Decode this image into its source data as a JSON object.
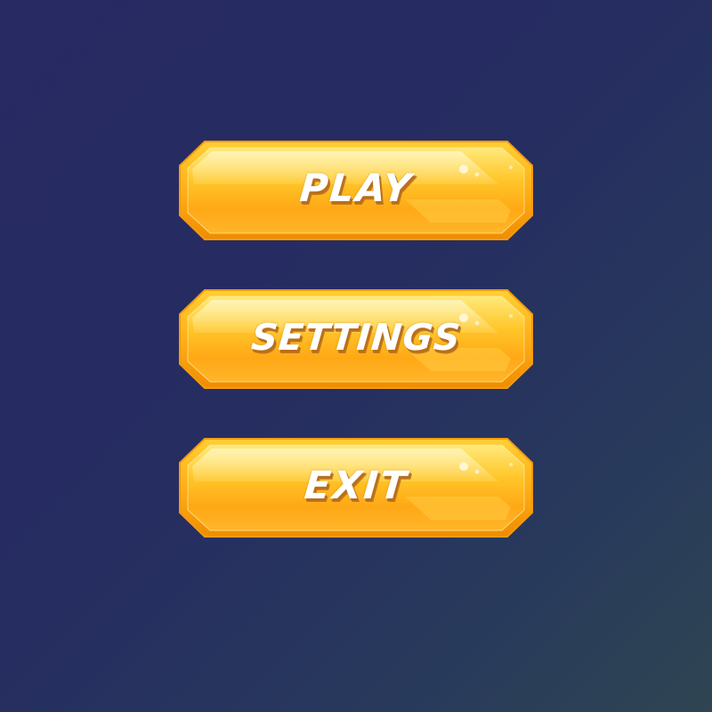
{
  "main_menu": {
    "buttons": [
      {
        "label": "PLAY"
      },
      {
        "label": "SETTINGS"
      },
      {
        "label": "EXIT"
      }
    ]
  },
  "colors": {
    "background_top": "#272a63",
    "background_bottom": "#2f4552",
    "button_fill_top": "#ffd44a",
    "button_fill_bottom": "#ff9f12",
    "button_border": "#f29a11",
    "label_color": "#ffffff",
    "label_shadow": "#b96e1b"
  }
}
